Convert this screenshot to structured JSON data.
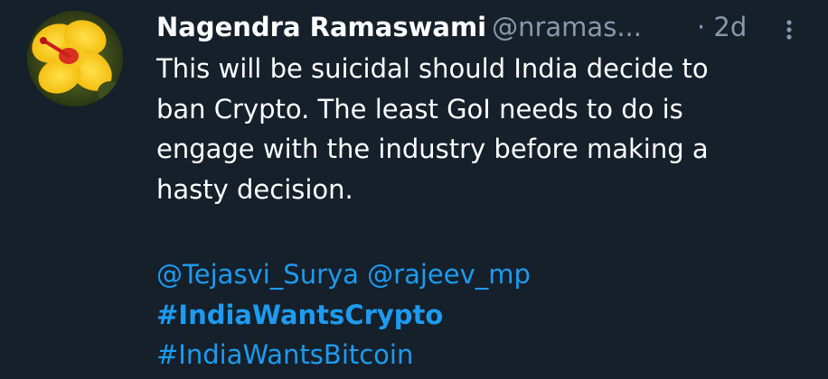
{
  "tweet": {
    "display_name": "Nagendra Ramaswami",
    "handle": "@nramas...",
    "timestamp": "· 2d",
    "text_lines": [
      "This will be suicidal should India decide to",
      "ban Crypto. The least GoI needs to do is",
      "engage with the industry before making a",
      "hasty decision."
    ],
    "mentions": [
      "@Tejasvi_Surya",
      "@rajeev_mp"
    ],
    "hashtags": [
      "#IndiaWantsCrypto",
      "#IndiaWantsBitcoin"
    ]
  },
  "colors": {
    "background": "#15202b",
    "text": "#ffffff",
    "secondary": "#8b98a5",
    "link": "#1d9bf0"
  },
  "icons": {
    "avatar": "hibiscus-flower-avatar",
    "more": "more-vertical-icon"
  }
}
